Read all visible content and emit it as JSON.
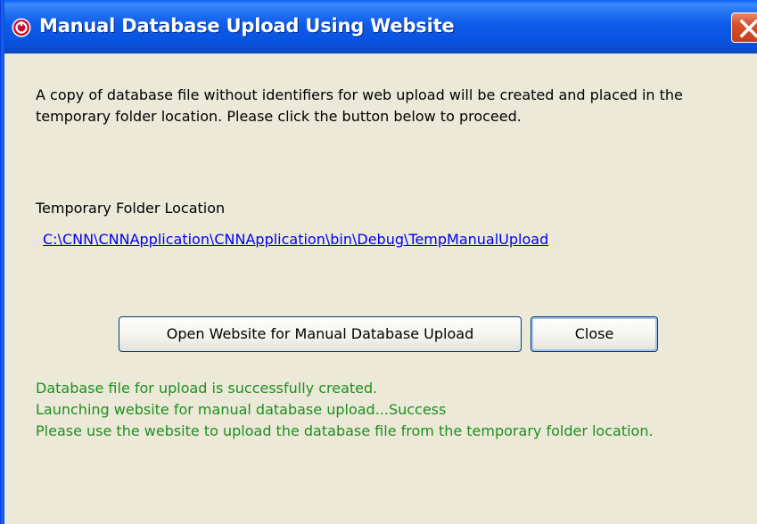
{
  "window": {
    "title": "Manual Database Upload Using Website",
    "app_icon": "cnn-app-icon",
    "close_icon": "close-icon"
  },
  "content": {
    "description": "A copy of database file without identifiers for web upload will be created and placed in the temporary folder location. Please click the button below to proceed.",
    "folder_label": "Temporary Folder Location",
    "folder_path": "C:\\CNN\\CNNApplication\\CNNApplication\\bin\\Debug\\TempManualUpload"
  },
  "buttons": {
    "open_website": "Open Website for Manual Database Upload",
    "close": "Close"
  },
  "status": {
    "lines": [
      "Database file for upload is successfully created.",
      "Launching website for manual database upload...Success",
      "Please use the website to upload the database file from the temporary folder location."
    ],
    "color": "#1E8F1E"
  },
  "colors": {
    "titlebar": "#0A55E3",
    "dialog_bg": "#ECE9D8",
    "link": "#0000EE",
    "close_button": "#D9532C"
  }
}
